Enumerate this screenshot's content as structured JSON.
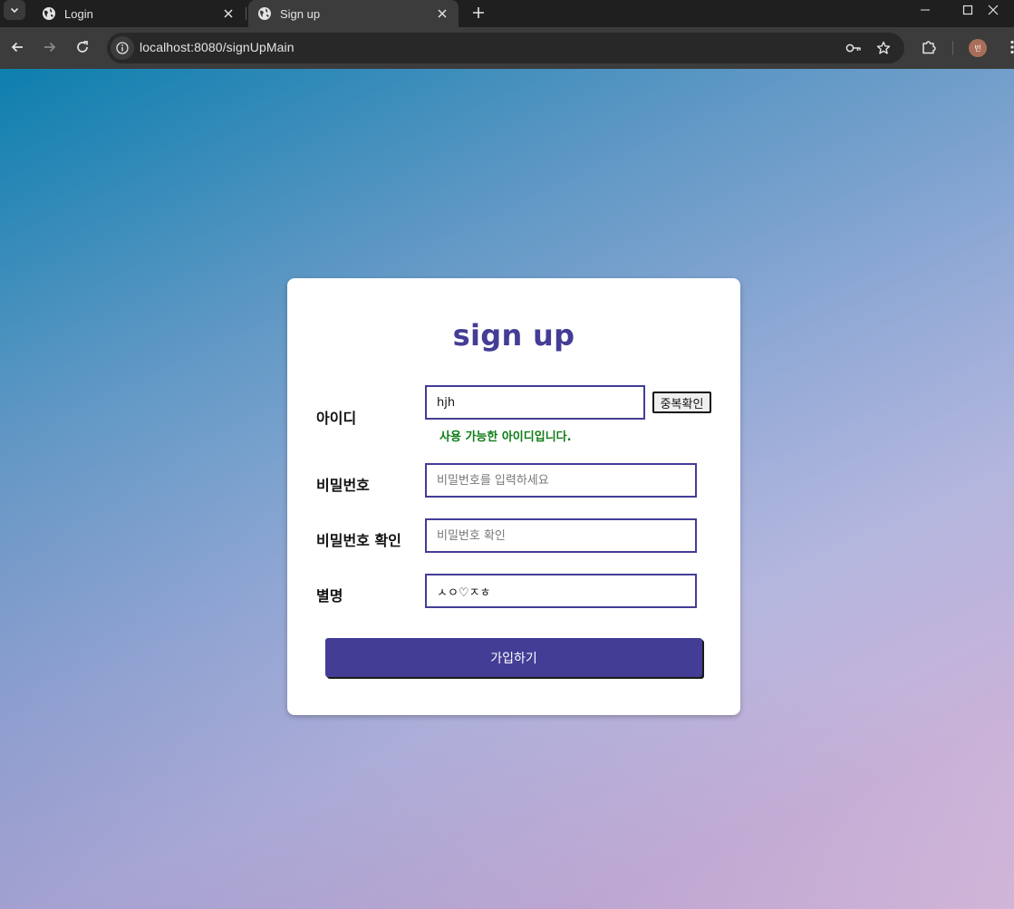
{
  "browser": {
    "tabs": [
      {
        "title": "Login",
        "active": false
      },
      {
        "title": "Sign up",
        "active": true
      }
    ],
    "url": "localhost:8080/signUpMain",
    "profile_initial": "빈"
  },
  "form": {
    "title": "sign up",
    "id": {
      "label": "아이디",
      "value": "hjh",
      "check_button": "중복확인",
      "status_message": "사용 가능한 아이디입니다."
    },
    "password": {
      "label": "비밀번호",
      "placeholder": "비밀번호를 입력하세요",
      "value": ""
    },
    "password_confirm": {
      "label": "비밀번호 확인",
      "placeholder": "비밀번호 확인",
      "value": ""
    },
    "nickname": {
      "label": "별명",
      "value": "ㅅㅇ♡ㅈㅎ"
    },
    "submit_label": "가입하기"
  },
  "colors": {
    "accent": "#433d96",
    "success": "#0f7d17"
  }
}
